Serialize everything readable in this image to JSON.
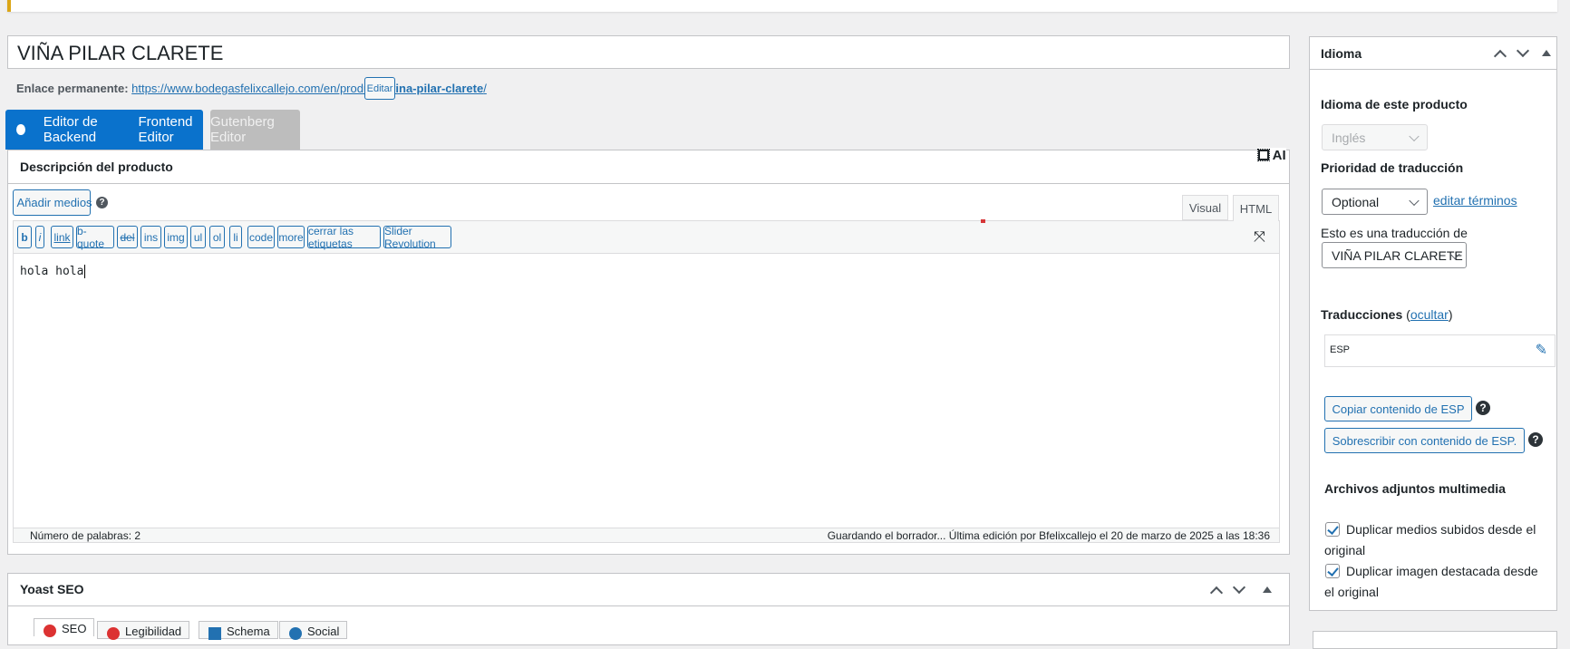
{
  "post": {
    "title": "VIÑA PILAR CLARETE",
    "permalink_label": "Enlace permanente:",
    "permalink_base": "https://www.bodegasfelixcallejo.com/en/producto/",
    "permalink_slug": "vina-pilar-clarete",
    "permalink_end": "/",
    "edit_label": "Editar"
  },
  "editor_tabs": {
    "backend": "Editor de Backend",
    "frontend": "Frontend Editor",
    "gutenberg": "Gutenberg Editor"
  },
  "description": {
    "title": "Descripción del producto",
    "ai_label": "AI",
    "add_media": "Añadir medios",
    "help": "?",
    "visual_tab": "Visual",
    "html_tab": "HTML",
    "quicktags": [
      "b",
      "i",
      "link",
      "b-quote",
      "del",
      "ins",
      "img",
      "ul",
      "ol",
      "li",
      "code",
      "more",
      "cerrar las etiquetas",
      "Slider Revolution"
    ],
    "content": "hola hola",
    "word_count": "Número de palabras: 2",
    "status": "Guardando el borrador... Última edición por Bfelixcallejo el 20 de marzo de 2025 a las 18:36"
  },
  "yoast": {
    "title": "Yoast SEO",
    "tabs": [
      "SEO",
      "Legibilidad",
      "Schema",
      "Social"
    ]
  },
  "sidebar": {
    "title": "Idioma",
    "language_label": "Idioma de este producto",
    "language_value": "Inglés",
    "priority_label": "Prioridad de traducción",
    "priority_value": "Optional",
    "edit_terms": "editar términos",
    "translation_of_label": "Esto es una traducción de",
    "translation_of_value": "VIÑA PILAR CLARETE",
    "translations_label": "Traducciones",
    "translations_toggle": "ocultar",
    "translation_lang": "ESP",
    "copy_button": "Copiar contenido de ESP",
    "overwrite_button": "Sobrescribir con contenido de ESP.",
    "help": "?",
    "media_label": "Archivos adjuntos multimedia",
    "checkbox_1": "Duplicar medios subidos desde el original",
    "checkbox_2": "Duplicar imagen destacada desde el original"
  }
}
